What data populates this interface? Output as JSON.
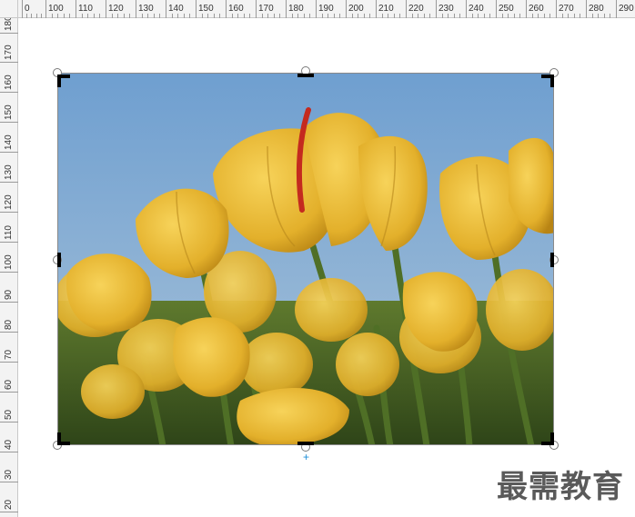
{
  "ruler_h": {
    "labels": [
      "0",
      "100",
      "110",
      "120",
      "130",
      "140",
      "150",
      "160",
      "170",
      "180",
      "190",
      "200",
      "210",
      "220",
      "230",
      "240",
      "250",
      "260",
      "270",
      "280",
      "290"
    ]
  },
  "ruler_v": {
    "labels": [
      "180",
      "170",
      "160",
      "150",
      "140",
      "130",
      "120",
      "110",
      "100",
      "90",
      "80",
      "70",
      "60",
      "50",
      "40",
      "30",
      "20"
    ]
  },
  "picture": {
    "description_name": "tulip-photo",
    "colors": {
      "sky": "#7ea7cf",
      "tulip": "#e6b52f",
      "stem": "#4a6a25",
      "red": "#c0261d"
    }
  },
  "watermark": {
    "text": "最需教育"
  },
  "move_cross": {
    "glyph": "+"
  }
}
